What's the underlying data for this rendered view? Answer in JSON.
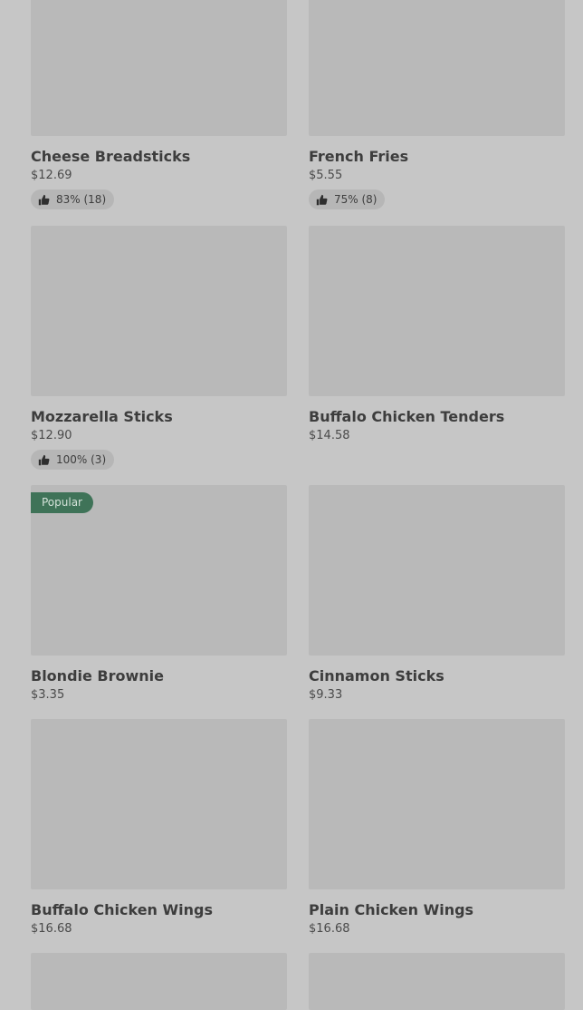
{
  "items": [
    {
      "name": "Cheese Breadsticks",
      "price": "$12.69",
      "rating": "83% (18)"
    },
    {
      "name": "French Fries",
      "price": "$5.55",
      "rating": "75% (8)"
    },
    {
      "name": "Mozzarella Sticks",
      "price": "$12.90",
      "rating": "100% (3)"
    },
    {
      "name": "Buffalo Chicken Tenders",
      "price": "$14.58"
    },
    {
      "name": "Blondie Brownie",
      "price": "$3.35",
      "badge": "Popular"
    },
    {
      "name": "Cinnamon Sticks",
      "price": "$9.33"
    },
    {
      "name": "Buffalo Chicken Wings",
      "price": "$16.68"
    },
    {
      "name": "Plain Chicken Wings",
      "price": "$16.68"
    }
  ],
  "colors": {
    "overlay": "#c6c6c6",
    "placeholder": "#b9b9b9",
    "badge": "#3f7358"
  }
}
